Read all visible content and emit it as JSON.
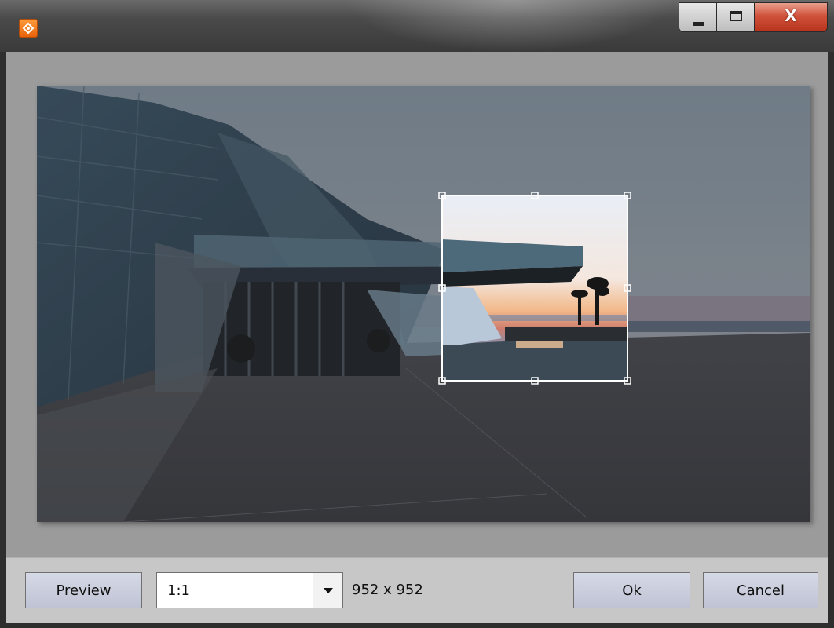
{
  "window": {
    "title": "",
    "controls": {
      "minimize": "minimize-icon",
      "maximize": "maximize-icon",
      "close": "X"
    },
    "accent": "#e8620a"
  },
  "editor": {
    "image": "photo of glass building with seaside promenade at sunset",
    "crop_box_color": "#ffffff"
  },
  "bottombar": {
    "preview_label": "Preview",
    "ratio_value": "1:1",
    "dimensions": "952 x 952",
    "ok_label": "Ok",
    "cancel_label": "Cancel"
  }
}
